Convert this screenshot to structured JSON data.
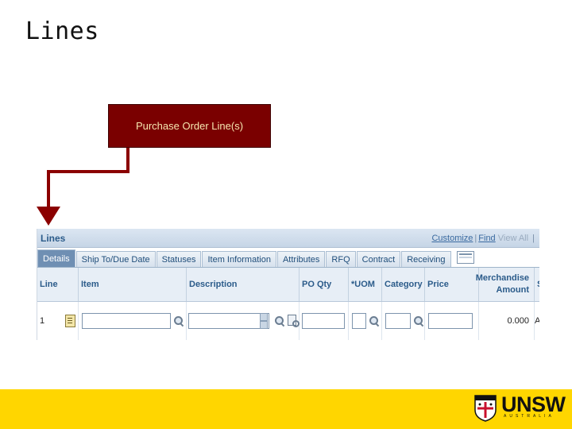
{
  "slide": {
    "title": "Lines",
    "callout": "Purchase Order Line(s)"
  },
  "panel": {
    "title": "Lines",
    "links": {
      "customize": "Customize",
      "find": "Find",
      "view_all": "View All",
      "sep": "|"
    },
    "tabs": [
      {
        "label": "Details",
        "active": true
      },
      {
        "label": "Ship To/Due Date",
        "active": false
      },
      {
        "label": "Statuses",
        "active": false
      },
      {
        "label": "Item Information",
        "active": false
      },
      {
        "label": "Attributes",
        "active": false
      },
      {
        "label": "RFQ",
        "active": false
      },
      {
        "label": "Contract",
        "active": false
      },
      {
        "label": "Receiving",
        "active": false
      }
    ],
    "columns": {
      "line": "Line",
      "item": "Item",
      "description": "Description",
      "po_qty": "PO Qty",
      "uom": "*UOM",
      "category": "Category",
      "price": "Price",
      "merch_line1": "Merchandise",
      "merch_line2": "Amount",
      "status_fragment": "S"
    },
    "row": {
      "line": "1",
      "item": "",
      "description": "",
      "po_qty": "",
      "uom": "",
      "category": "",
      "price": "",
      "amount": "0.000",
      "status_fragment": "A"
    }
  },
  "footer": {
    "brand": "UNSW",
    "sub": "AUSTRALIA",
    "color": "#ffd600"
  },
  "colors": {
    "callout_bg": "#7a0000",
    "callout_text": "#f6e7b0",
    "arrow": "#8b0000"
  }
}
